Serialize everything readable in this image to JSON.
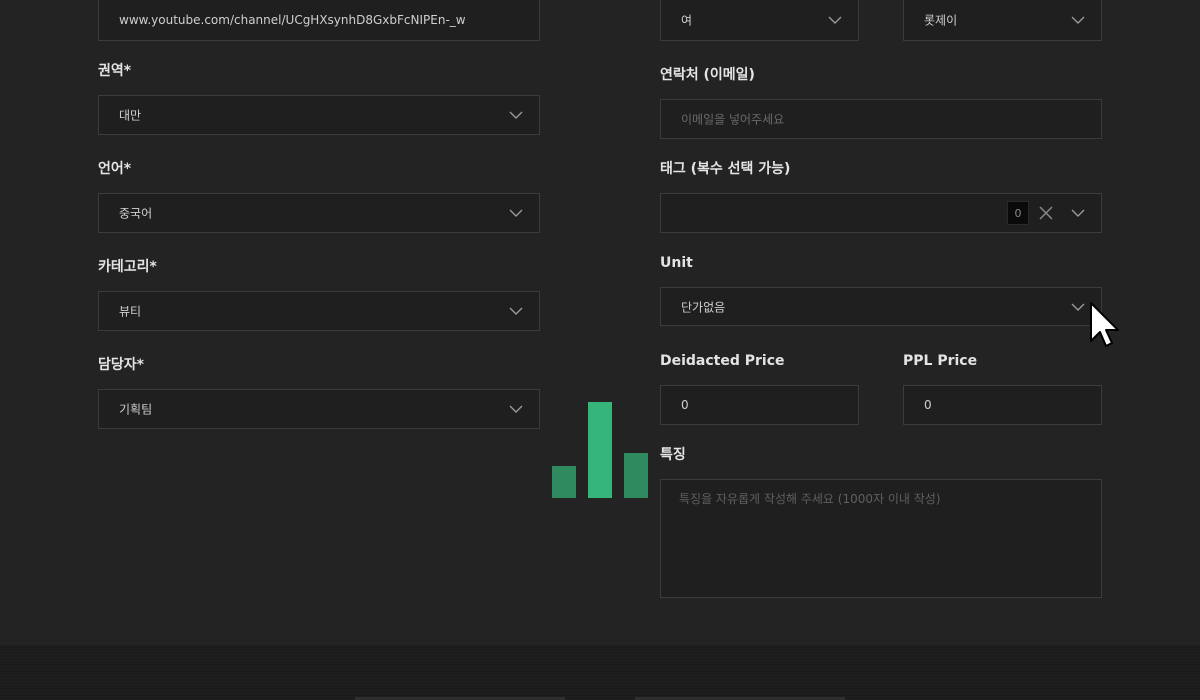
{
  "left": {
    "url_value": "www.youtube.com/channel/UCgHXsynhD8GxbFcNIPEn-_w",
    "region": {
      "label": "권역*",
      "value": "대만"
    },
    "language": {
      "label": "언어*",
      "value": "중국어"
    },
    "category": {
      "label": "카테고리*",
      "value": "뷰티"
    },
    "manager": {
      "label": "담당자*",
      "value": "기획팀"
    }
  },
  "right": {
    "gender_value": "여",
    "top_right_value": "롯제이",
    "email": {
      "label": "연락처 (이메일)",
      "placeholder": "이메일을 넣어주세요"
    },
    "tags": {
      "label": "태그 (복수 선택 가능)",
      "count": "0"
    },
    "unit": {
      "label": "Unit",
      "value": "단가없음"
    },
    "dedicated_price": {
      "label": "Deidacted Price",
      "value": "0"
    },
    "ppl_price": {
      "label": "PPL Price",
      "value": "0"
    },
    "features": {
      "label": "특징",
      "placeholder": "특징을 자유롭게 작성해 주세요 (1000자 이내 작성)"
    }
  },
  "loader": {
    "bars": [
      0.33,
      1.0,
      0.47
    ],
    "color": "#2f8a5f",
    "highlight_color": "#35b57a"
  }
}
